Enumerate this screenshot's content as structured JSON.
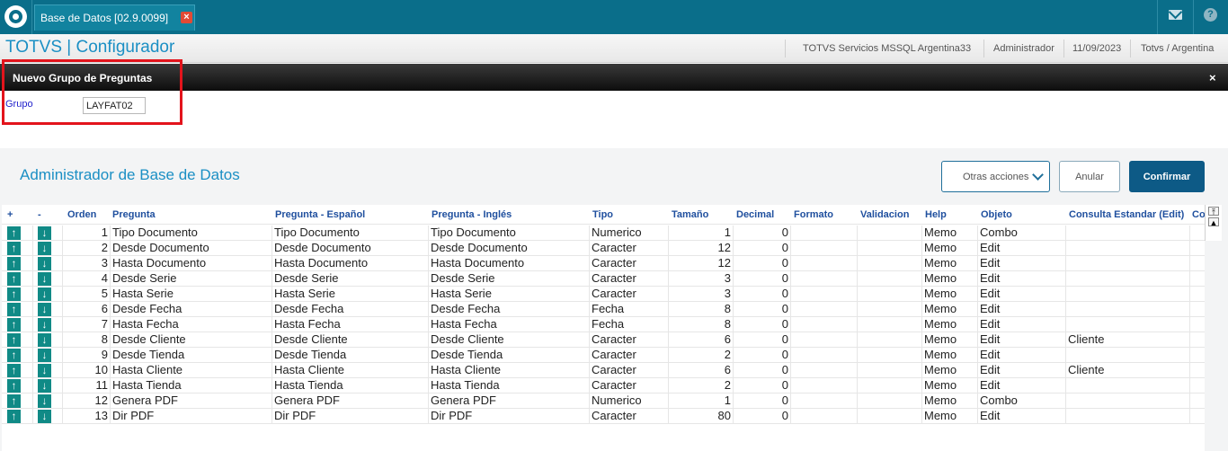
{
  "topbar": {
    "tab_label": "Base de Datos [02.9.0099]",
    "tab_close": "×",
    "help_glyph": "?"
  },
  "header": {
    "title": "TOTVS | Configurador",
    "server": "TOTVS Servicios MSSQL Argentina33",
    "user": "Administrador",
    "date": "11/09/2023",
    "company": "Totvs / Argentina"
  },
  "dialog": {
    "title": "Nuevo Grupo de Preguntas",
    "close": "×"
  },
  "form": {
    "grupo_label": "Grupo",
    "grupo_value": "LAYFAT02"
  },
  "section": {
    "title": "Administrador de Base de Datos",
    "otras": "Otras acciones",
    "anular": "Anular",
    "confirmar": "Confirmar"
  },
  "grid": {
    "headers": [
      "+",
      "-",
      "Orden",
      "Pregunta",
      "Pregunta - Español",
      "Pregunta - Inglés",
      "Tipo",
      "Tamaño",
      "Decimal",
      "Formato",
      "Validacion",
      "Help",
      "Objeto",
      "Consulta Estandar (Edit)",
      "Co"
    ],
    "rows": [
      [
        "1",
        "Tipo Documento",
        "Tipo Documento",
        "Tipo Documento",
        "Numerico",
        "1",
        "0",
        "",
        "",
        "Memo",
        "Combo",
        ""
      ],
      [
        "2",
        "Desde Documento",
        "Desde Documento",
        "Desde Documento",
        "Caracter",
        "12",
        "0",
        "",
        "",
        "Memo",
        "Edit",
        ""
      ],
      [
        "3",
        "Hasta Documento",
        "Hasta Documento",
        "Hasta Documento",
        "Caracter",
        "12",
        "0",
        "",
        "",
        "Memo",
        "Edit",
        ""
      ],
      [
        "4",
        "Desde Serie",
        "Desde Serie",
        "Desde Serie",
        "Caracter",
        "3",
        "0",
        "",
        "",
        "Memo",
        "Edit",
        ""
      ],
      [
        "5",
        "Hasta Serie",
        "Hasta Serie",
        "Hasta Serie",
        "Caracter",
        "3",
        "0",
        "",
        "",
        "Memo",
        "Edit",
        ""
      ],
      [
        "6",
        "Desde Fecha",
        "Desde Fecha",
        "Desde Fecha",
        "Fecha",
        "8",
        "0",
        "",
        "",
        "Memo",
        "Edit",
        ""
      ],
      [
        "7",
        "Hasta Fecha",
        "Hasta Fecha",
        "Hasta Fecha",
        "Fecha",
        "8",
        "0",
        "",
        "",
        "Memo",
        "Edit",
        ""
      ],
      [
        "8",
        "Desde Cliente",
        "Desde Cliente",
        "Desde Cliente",
        "Caracter",
        "6",
        "0",
        "",
        "",
        "Memo",
        "Edit",
        "Cliente"
      ],
      [
        "9",
        "Desde Tienda",
        "Desde Tienda",
        "Desde Tienda",
        "Caracter",
        "2",
        "0",
        "",
        "",
        "Memo",
        "Edit",
        ""
      ],
      [
        "10",
        "Hasta Cliente",
        "Hasta Cliente",
        "Hasta Cliente",
        "Caracter",
        "6",
        "0",
        "",
        "",
        "Memo",
        "Edit",
        "Cliente"
      ],
      [
        "11",
        "Hasta Tienda",
        "Hasta Tienda",
        "Hasta Tienda",
        "Caracter",
        "2",
        "0",
        "",
        "",
        "Memo",
        "Edit",
        ""
      ],
      [
        "12",
        "Genera PDF",
        "Genera PDF",
        "Genera PDF",
        "Numerico",
        "1",
        "0",
        "",
        "",
        "Memo",
        "Combo",
        ""
      ],
      [
        "13",
        "Dir PDF",
        "Dir PDF",
        "Dir PDF",
        "Caracter",
        "80",
        "0",
        "",
        "",
        "Memo",
        "Edit",
        ""
      ]
    ],
    "up_glyph": "↑",
    "down_glyph": "↓"
  },
  "scroll": {
    "top_glyph": "⤒",
    "up_glyph": "▲"
  },
  "colors": {
    "brand": "#0a6e8a",
    "accent": "#1b8fc4",
    "confirm": "#0d5a86",
    "highlight": "#e3141c",
    "arrow": "#108a86"
  }
}
